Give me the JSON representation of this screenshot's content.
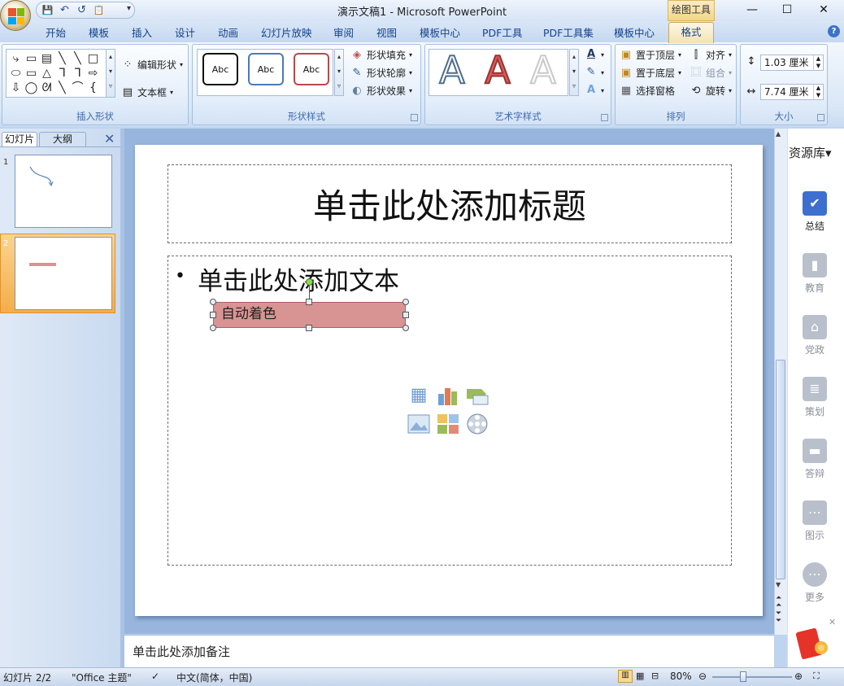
{
  "window": {
    "title": "演示文稿1 - Microsoft PowerPoint",
    "context_tools_label": "绘图工具"
  },
  "quick_access": {
    "save": "💾",
    "undo": "↶",
    "redo": "↺",
    "paste": "📋",
    "more": "▾"
  },
  "tabs": [
    "开始",
    "模板",
    "插入",
    "设计",
    "动画",
    "幻灯片放映",
    "审阅",
    "视图",
    "模板中心",
    "PDF工具",
    "PDF工具集",
    "模板中心"
  ],
  "active_tab": "格式",
  "ribbon": {
    "insert_shapes": {
      "caption": "插入形状",
      "edit_shape": "编辑形状",
      "text_box": "文本框",
      "shapes": [
        "⤷",
        "▭",
        "▤",
        "╲",
        "╲",
        "□",
        "⬭",
        "▭",
        "△",
        "ᒣ",
        "ᒣ",
        "⇨",
        "⇩",
        "◯",
        "ᘛ",
        "╲",
        "⌒",
        "{"
      ]
    },
    "shape_styles": {
      "caption": "形状样式",
      "samples": [
        "Abc",
        "Abc",
        "Abc"
      ],
      "fill": "形状填充",
      "outline": "形状轮廓",
      "effects": "形状效果"
    },
    "wordart_styles": {
      "caption": "艺术字样式",
      "letters": [
        "A",
        "A",
        "A"
      ]
    },
    "arrange": {
      "caption": "排列",
      "bring_front": "置于顶层",
      "send_back": "置于底层",
      "selection_pane": "选择窗格",
      "align": "对齐",
      "group": "组合",
      "rotate": "旋转"
    },
    "size": {
      "caption": "大小",
      "height": "1.03 厘米",
      "width": "7.74 厘米"
    }
  },
  "left_pane": {
    "tab_slides": "幻灯片",
    "tab_outline": "大纲",
    "close": "✕",
    "slides": [
      {
        "num": "1"
      },
      {
        "num": "2"
      }
    ]
  },
  "slide": {
    "title_placeholder": "单击此处添加标题",
    "body_placeholder": "单击此处添加文本",
    "bullet": "•",
    "shape_text": "自动着色"
  },
  "notes_placeholder": "单击此处添加备注",
  "resource_pane": {
    "title": "资源库▾",
    "items": [
      {
        "label": "总结",
        "icon": "summary-icon",
        "active": true
      },
      {
        "label": "教育",
        "icon": "book-icon",
        "active": false
      },
      {
        "label": "党政",
        "icon": "building-icon",
        "active": false
      },
      {
        "label": "策划",
        "icon": "plan-icon",
        "active": false
      },
      {
        "label": "答辩",
        "icon": "chat-icon",
        "active": false
      },
      {
        "label": "图示",
        "icon": "diagram-icon",
        "active": false
      },
      {
        "label": "更多",
        "icon": "more-icon",
        "active": false
      }
    ]
  },
  "status": {
    "slide_info": "幻灯片 2/2",
    "theme": "\"Office 主题\"",
    "language": "中文(简体，中国)",
    "zoom": "80%"
  },
  "colors": {
    "shape_fill": "#d89393",
    "selected_thumb": "#f5ad4a",
    "ribbon_text": "#15428b"
  }
}
